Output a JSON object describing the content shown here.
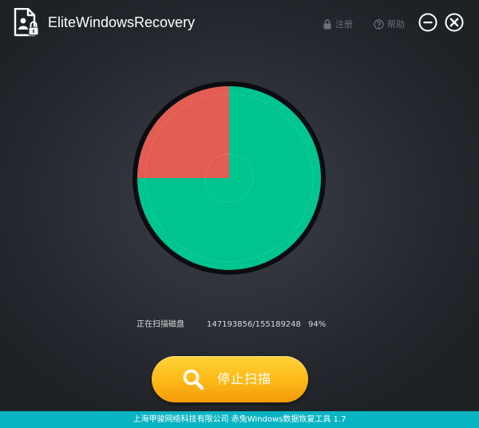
{
  "app": {
    "title": "EliteWindowsRecovery",
    "logo_icon": "document-lock-icon"
  },
  "header": {
    "register_label": "注册",
    "register_icon": "lock-icon",
    "help_label": "帮助",
    "help_icon": "question-icon",
    "minimize_icon": "minimize-icon",
    "close_icon": "close-icon"
  },
  "scan": {
    "status_label": "正在扫描磁盘",
    "sectors_text": "147193856/155189248",
    "percent_text": "94%",
    "scanned": 147193856,
    "total": 155189248,
    "progress_percent": 94,
    "sector_map": {
      "scanned_color": "#00c58e",
      "highlight_color": "#e35d52",
      "highlight_fraction": 0.25,
      "ring_color": "#0a0c10"
    }
  },
  "actions": {
    "stop_label": "停止扫描",
    "stop_icon": "search-icon"
  },
  "footer": {
    "text": "上海甲骏网络科技有限公司 赤兔Windows数据恢复工具 1.7",
    "background": "#08b4c2"
  },
  "colors": {
    "accent_yellow": "#ffc21f",
    "muted_text": "#6b7079"
  }
}
